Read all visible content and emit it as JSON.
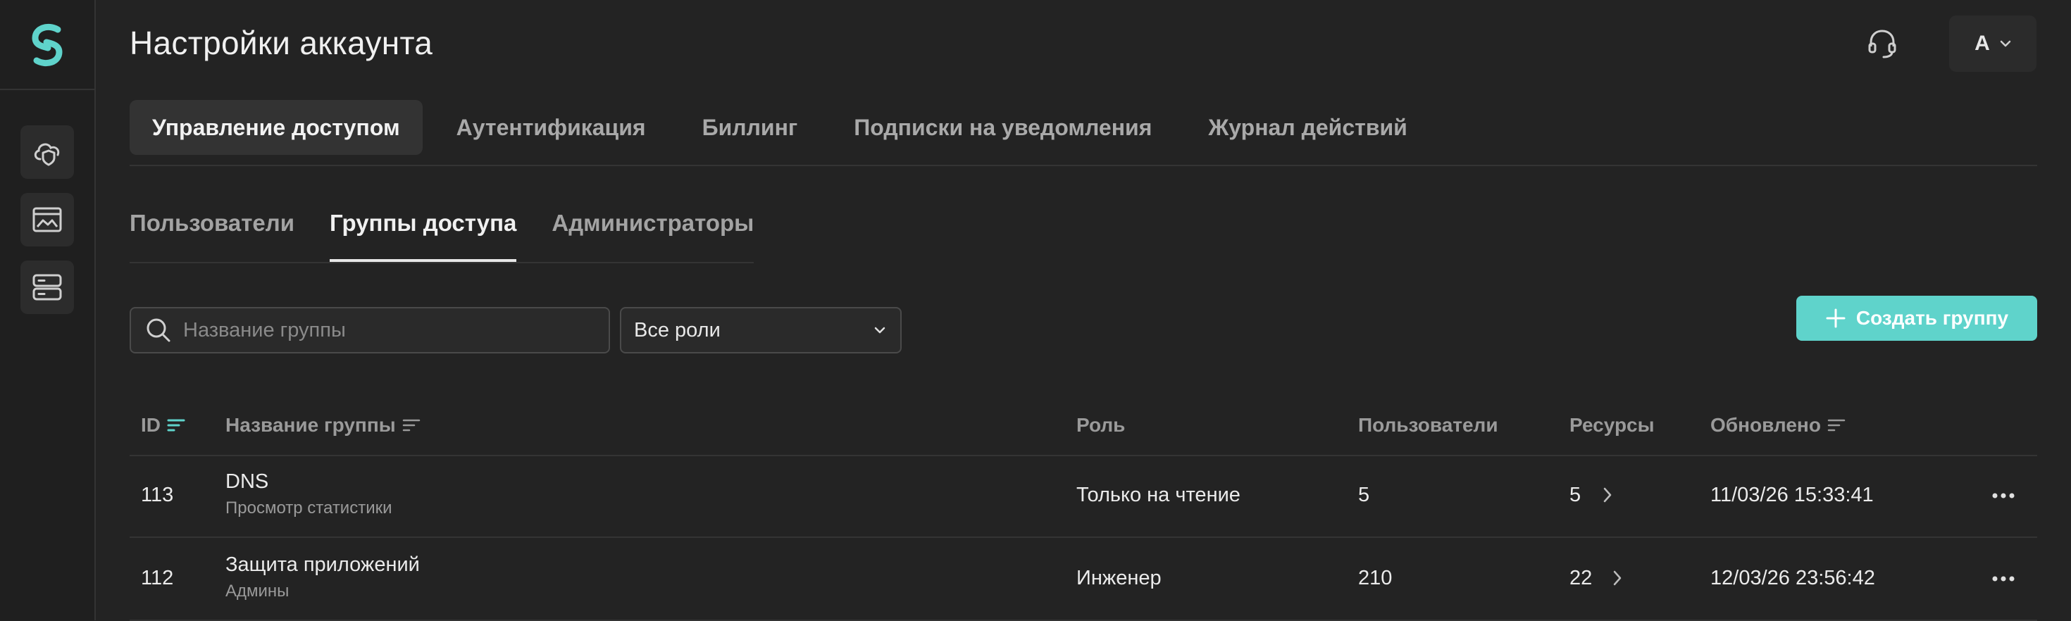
{
  "colors": {
    "accent": "#5fd3cb",
    "background": "#232323",
    "rail": "#1f1f1f"
  },
  "header": {
    "title": "Настройки аккаунта",
    "user_initial": "A"
  },
  "tabs": [
    {
      "label": "Управление доступом",
      "active": true
    },
    {
      "label": "Аутентификация",
      "active": false
    },
    {
      "label": "Биллинг",
      "active": false
    },
    {
      "label": "Подписки на уведомления",
      "active": false
    },
    {
      "label": "Журнал действий",
      "active": false
    }
  ],
  "subtabs": [
    {
      "label": "Пользователи",
      "active": false
    },
    {
      "label": "Группы доступа",
      "active": true
    },
    {
      "label": "Администраторы",
      "active": false
    }
  ],
  "search": {
    "placeholder": "Название группы",
    "value": ""
  },
  "role_filter": {
    "selected": "Все роли"
  },
  "create_button": {
    "label": "Создать группу"
  },
  "table": {
    "columns": {
      "id": "ID",
      "name": "Название группы",
      "role": "Роль",
      "users": "Пользователи",
      "resources": "Ресурсы",
      "updated": "Обновлено"
    },
    "rows": [
      {
        "id": "113",
        "name": "DNS",
        "description": "Просмотр статистики",
        "role": "Только на чтение",
        "users": "5",
        "resources": "5",
        "updated": "11/03/26 15:33:41"
      },
      {
        "id": "112",
        "name": "Защита приложений",
        "description": "Админы",
        "role": "Инженер",
        "users": "210",
        "resources": "22",
        "updated": "12/03/26 23:56:42"
      }
    ]
  }
}
